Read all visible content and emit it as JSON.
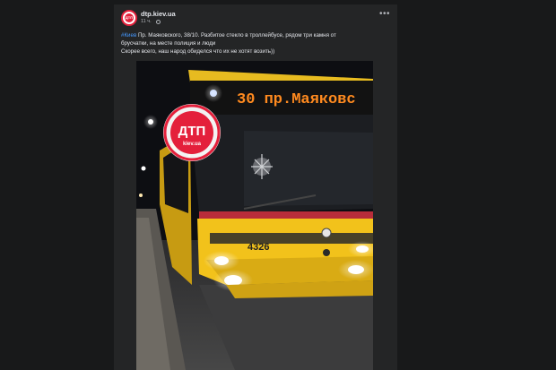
{
  "post": {
    "page_name": "dtp.kiev.ua",
    "timestamp": "11 ч.",
    "more_icon": "more-horizontal-icon",
    "hashtag": "#Киев",
    "line1": " Пр. Маяковского, 38/10. Разбитое стекло в троллейбусе, рядом три камня от",
    "line2": "брусчатки, на месте полиция и люди",
    "line3": "Скорее всего, наш народ обиделся что их не хотят возить))"
  },
  "photo": {
    "route_sign": "30 пр.Маяковс",
    "fleet_number": "4326",
    "logo_text": "ДТП",
    "logo_url": "kiev.ua"
  },
  "colors": {
    "background": "#18191a",
    "card": "#242526",
    "link": "#4599ff",
    "trolleybus": "#f2c21b",
    "logo_red": "#e4203b"
  }
}
